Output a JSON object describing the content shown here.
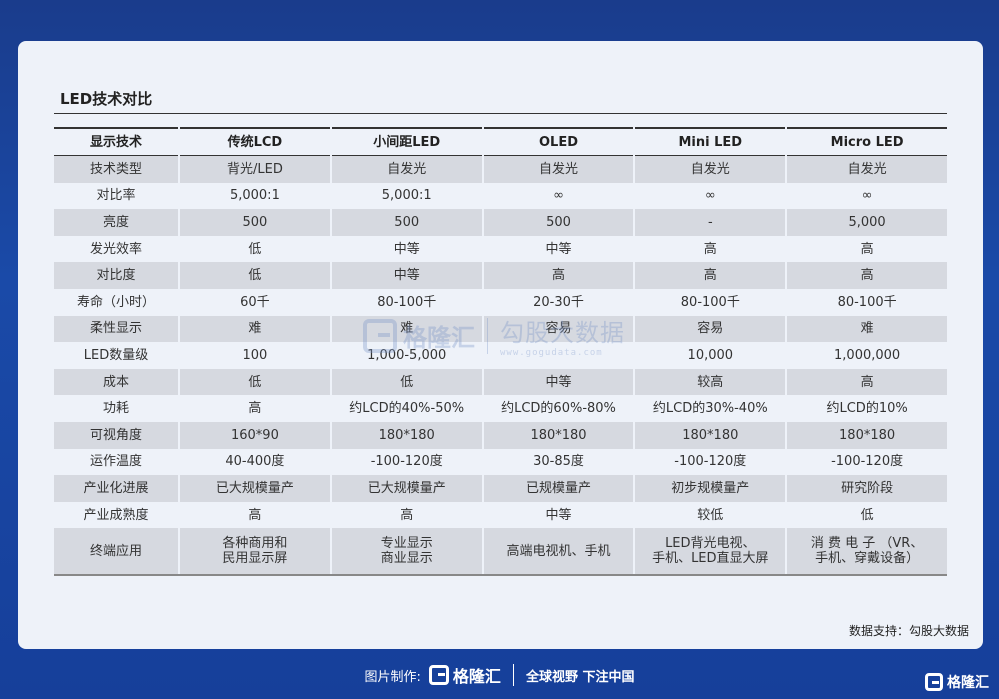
{
  "title": "LED技术对比",
  "table": {
    "headers": [
      "显示技术",
      "传统LCD",
      "小间距LED",
      "OLED",
      "Mini LED",
      "Micro LED"
    ],
    "rows": [
      [
        "技术类型",
        "背光/LED",
        "自发光",
        "自发光",
        "自发光",
        "自发光"
      ],
      [
        "对比率",
        "5,000:1",
        "5,000:1",
        "∞",
        "∞",
        "∞"
      ],
      [
        "亮度",
        "500",
        "500",
        "500",
        "-",
        "5,000"
      ],
      [
        "发光效率",
        "低",
        "中等",
        "中等",
        "高",
        "高"
      ],
      [
        "对比度",
        "低",
        "中等",
        "高",
        "高",
        "高"
      ],
      [
        "寿命（小时）",
        "60千",
        "80-100千",
        "20-30千",
        "80-100千",
        "80-100千"
      ],
      [
        "柔性显示",
        "难",
        "难",
        "容易",
        "容易",
        "难"
      ],
      [
        "LED数量级",
        "100",
        "1,000-5,000",
        "",
        "10,000",
        "1,000,000"
      ],
      [
        "成本",
        "低",
        "低",
        "中等",
        "较高",
        "高"
      ],
      [
        "功耗",
        "高",
        "约LCD的40%-50%",
        "约LCD的60%-80%",
        "约LCD的30%-40%",
        "约LCD的10%"
      ],
      [
        "可视角度",
        "160*90",
        "180*180",
        "180*180",
        "180*180",
        "180*180"
      ],
      [
        "运作温度",
        "40-400度",
        "-100-120度",
        "30-85度",
        "-100-120度",
        "-100-120度"
      ],
      [
        "产业化进展",
        "已大规模量产",
        "已大规模量产",
        "已规模量产",
        "初步规模量产",
        "研究阶段"
      ],
      [
        "产业成熟度",
        "高",
        "高",
        "中等",
        "较低",
        "低"
      ]
    ],
    "last_row": {
      "label": "终端应用",
      "lcd": [
        "各种商用和",
        "民用显示屏"
      ],
      "fine_pitch": [
        "专业显示",
        "商业显示"
      ],
      "oled": [
        "高端电视机、手机"
      ],
      "mini": [
        "LED背光电视、",
        "手机、LED直显大屏"
      ],
      "micro": [
        "消 费 电 子 （VR、",
        "手机、穿戴设备）"
      ]
    }
  },
  "source": "数据支持：勾股大数据",
  "watermark": {
    "brand": "格隆汇",
    "cn": "勾股大数据",
    "url": "www.gogudata.com"
  },
  "footer": {
    "made_by": "图片制作:",
    "brand": "格隆汇",
    "slogan": "全球视野 下注中国"
  },
  "corner_brand": "格隆汇"
}
